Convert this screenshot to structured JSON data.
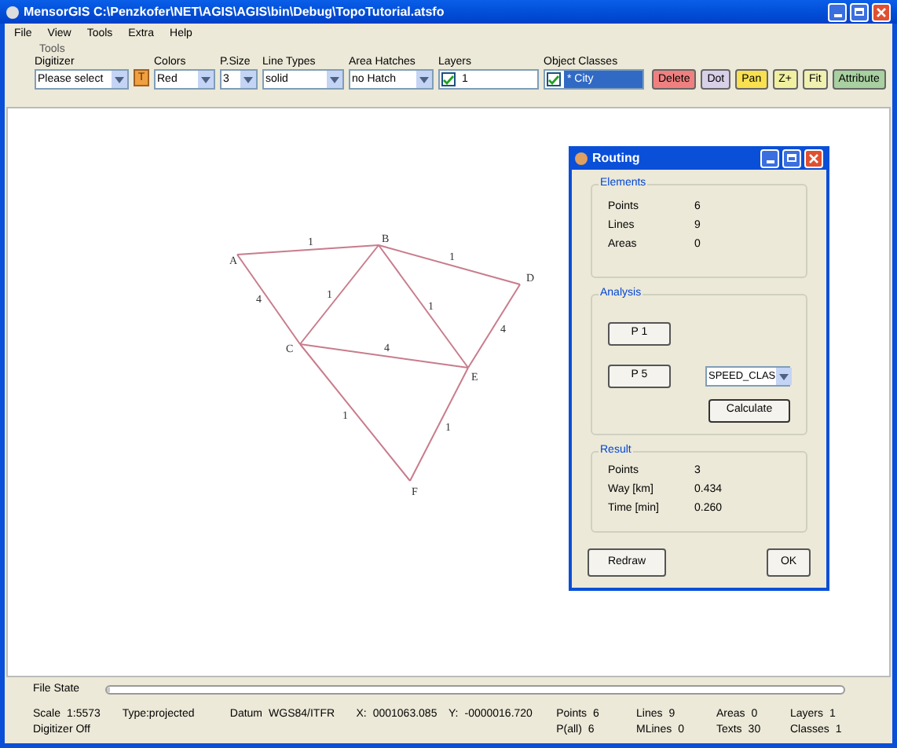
{
  "window": {
    "title": "MensorGIS C:\\Penzkofer\\NET\\AGIS\\AGIS\\bin\\Debug\\TopoTutorial.atsfo"
  },
  "menu": [
    "File",
    "View",
    "Tools",
    "Extra",
    "Help"
  ],
  "toolbar": {
    "group_label": "Tools",
    "fields": [
      {
        "label": "Digitizer",
        "value": "Please select",
        "kind": "dropdown"
      },
      {
        "value": "T",
        "kind": "tool"
      },
      {
        "label": "Colors",
        "value": "Red",
        "kind": "dropdown"
      },
      {
        "label": "P.Size",
        "value": "3",
        "kind": "dropdown"
      },
      {
        "label": "Line Types",
        "value": "solid",
        "kind": "dropdown"
      },
      {
        "label": "Area Hatches",
        "value": "no Hatch",
        "kind": "dropdown"
      },
      {
        "label": "Layers",
        "value": "1",
        "kind": "checklist",
        "checked": true,
        "selected": false
      },
      {
        "label": "Object Classes",
        "value": "* City",
        "kind": "checklist",
        "checked": true,
        "selected": true
      }
    ],
    "buttons": [
      {
        "label": "Delete",
        "color": "#f08080"
      },
      {
        "label": "Dot",
        "color": "#d8d0e8"
      },
      {
        "label": "Pan",
        "color": "#f8e050"
      },
      {
        "label": "Z+",
        "color": "#f0f0a0"
      },
      {
        "label": "Fit",
        "color": "#f0f0b0"
      },
      {
        "label": "Attribute",
        "color": "#a8d0a0"
      }
    ]
  },
  "graph": {
    "nodes": [
      {
        "label": "A"
      },
      {
        "label": "B"
      },
      {
        "label": "C"
      },
      {
        "label": "D"
      },
      {
        "label": "E"
      },
      {
        "label": "F"
      }
    ],
    "edges": [
      {
        "weight": "1"
      },
      {
        "weight": "1"
      },
      {
        "weight": "4"
      },
      {
        "weight": "1"
      },
      {
        "weight": "1"
      },
      {
        "weight": "4"
      },
      {
        "weight": "4"
      },
      {
        "weight": "1"
      },
      {
        "weight": "1"
      }
    ]
  },
  "routing": {
    "title": "Routing",
    "elements": {
      "label": "Elements",
      "rows": [
        {
          "name": "Points",
          "value": "6"
        },
        {
          "name": "Lines",
          "value": "9"
        },
        {
          "name": "Areas",
          "value": "0"
        }
      ]
    },
    "analysis": {
      "label": "Analysis",
      "start": "P 1",
      "end": "P 5",
      "attribute": "SPEED_CLAS",
      "calculate": "Calculate"
    },
    "result": {
      "label": "Result",
      "rows": [
        {
          "name": "Points",
          "value": "3"
        },
        {
          "name": "Way [km]",
          "value": "0.434"
        },
        {
          "name": "Time [min]",
          "value": "0.260"
        }
      ]
    },
    "buttons": [
      "Redraw",
      "OK"
    ]
  },
  "status": {
    "file_state": "File State",
    "progress": {
      "level": 0
    },
    "cells": [
      [
        {
          "label": "Scale",
          "value": "1:5573"
        },
        {
          "label": "Digitizer Off"
        }
      ],
      [
        {
          "label": "Type:projected"
        }
      ],
      [
        {
          "label": "Datum",
          "value": "WGS84/ITFR"
        }
      ],
      [
        {
          "label": "X:",
          "value": "0001063.085"
        }
      ],
      [
        {
          "label": "Y:",
          "value": "-0000016.720"
        }
      ],
      [
        {
          "label": "Points",
          "value": "6"
        },
        {
          "label": "P(all)",
          "value": "6"
        }
      ],
      [
        {
          "label": "Lines",
          "value": "9"
        },
        {
          "label": "MLines",
          "value": "0"
        }
      ],
      [
        {
          "label": "Areas",
          "value": "0"
        },
        {
          "label": "Texts",
          "value": "30"
        }
      ],
      [
        {
          "label": "Layers",
          "value": "1"
        },
        {
          "label": "Classes",
          "value": "1"
        }
      ]
    ]
  }
}
